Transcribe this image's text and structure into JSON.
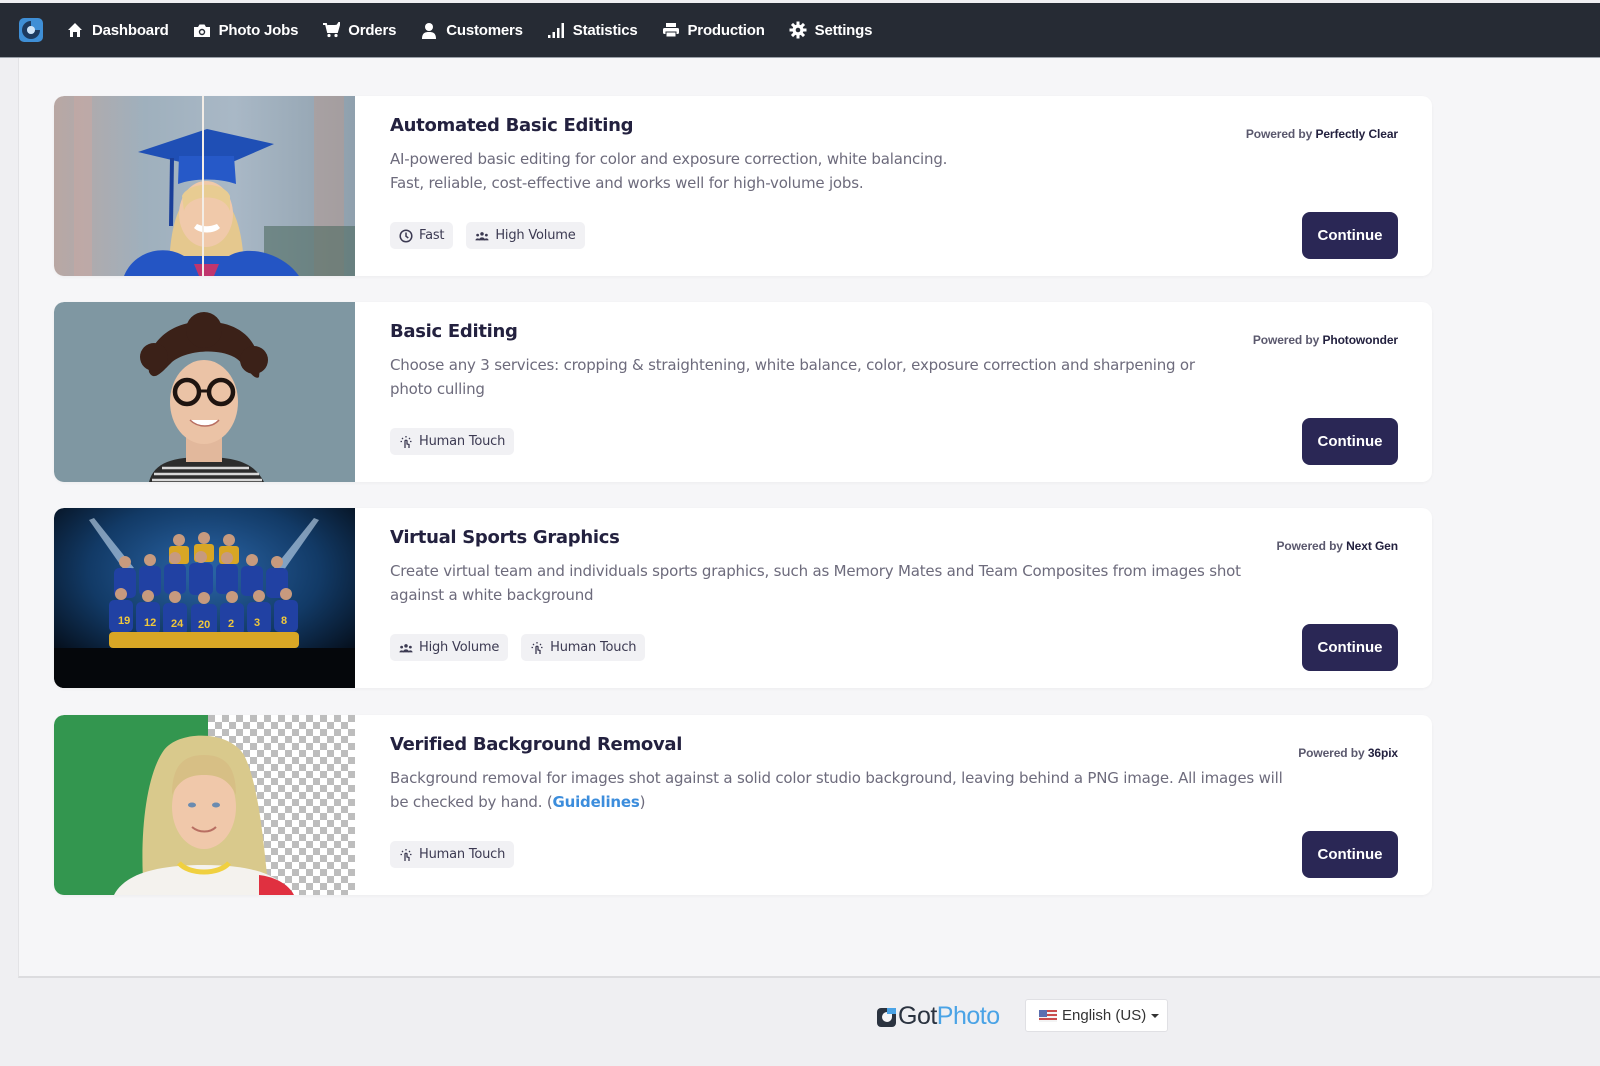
{
  "nav": {
    "logo": "gotphoto-logo",
    "items": [
      {
        "label": "Dashboard",
        "icon": "home-icon"
      },
      {
        "label": "Photo Jobs",
        "icon": "camera-icon"
      },
      {
        "label": "Orders",
        "icon": "cart-icon"
      },
      {
        "label": "Customers",
        "icon": "user-icon"
      },
      {
        "label": "Statistics",
        "icon": "bar-chart-icon"
      },
      {
        "label": "Production",
        "icon": "printer-icon"
      },
      {
        "label": "Settings",
        "icon": "gear-icon"
      }
    ]
  },
  "services": [
    {
      "title": "Automated Basic Editing",
      "description_line1": "AI-powered basic editing for color and exposure correction, white balancing.",
      "description_line2": "Fast, reliable, cost-effective and works well for high-volume jobs.",
      "powered_prefix": "Powered by",
      "vendor": "Perfectly Clear",
      "tags": [
        {
          "label": "Fast",
          "icon": "clock-icon"
        },
        {
          "label": "High Volume",
          "icon": "group-icon"
        }
      ],
      "button": "Continue",
      "image": "graduate-before-after-photo"
    },
    {
      "title": "Basic Editing",
      "description": "Choose any 3 services: cropping & straightening, white balance, color, exposure correction and sharpening or photo culling",
      "powered_prefix": "Powered by",
      "vendor": "Photowonder",
      "tags": [
        {
          "label": "Human Touch",
          "icon": "hand-touch-icon"
        }
      ],
      "button": "Continue",
      "image": "portrait-glasses-photo"
    },
    {
      "title": "Virtual Sports Graphics",
      "description": "Create virtual team and individuals sports graphics, such as Memory Mates and Team Composites from images shot against a white background",
      "powered_prefix": "Powered by",
      "vendor": "Next Gen",
      "tags": [
        {
          "label": "High Volume",
          "icon": "group-icon"
        },
        {
          "label": "Human Touch",
          "icon": "hand-touch-icon"
        }
      ],
      "button": "Continue",
      "image": "football-team-photo"
    },
    {
      "title": "Verified Background Removal",
      "description": "Background removal for images shot against a solid color studio background, leaving behind a PNG image. All images will be checked by hand. (",
      "link": "Guidelines",
      "description_end": ")",
      "powered_prefix": "Powered by",
      "vendor": "36pix",
      "tags": [
        {
          "label": "Human Touch",
          "icon": "hand-touch-icon"
        }
      ],
      "button": "Continue",
      "image": "background-removal-photo"
    }
  ],
  "footer": {
    "brand_got": "Got",
    "brand_photo": "Photo",
    "language": "English (US)"
  },
  "colors": {
    "nav_bg": "#262b34",
    "button_bg": "#2a2755",
    "title": "#23213f",
    "link": "#3c8ddc",
    "brand_blue": "#4aa3e6"
  }
}
